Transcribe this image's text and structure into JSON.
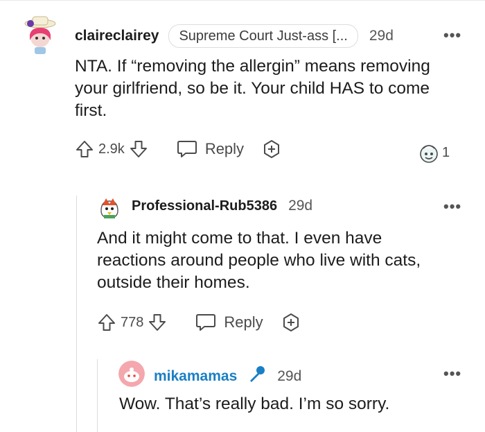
{
  "comments": [
    {
      "username": "claireclairey",
      "flair": "Supreme Court Just-ass [...",
      "age": "29d",
      "body": "NTA. If “removing the allergin” means removing your girlfriend, so be it. Your child HAS to come first.",
      "votes": "2.9k",
      "reply_label": "Reply",
      "award_count": "1"
    },
    {
      "username": "Professional-Rub5386",
      "age": "29d",
      "body": "And it might come to that. I even have reactions around people who live with cats, outside their homes.",
      "votes": "778",
      "reply_label": "Reply"
    },
    {
      "username": "mikamamas",
      "age": "29d",
      "body": "Wow. That’s really bad. I’m so sorry.",
      "role_icon": "microphone-icon",
      "username_color": "#1a7fc4"
    }
  ],
  "more_label": "•••"
}
